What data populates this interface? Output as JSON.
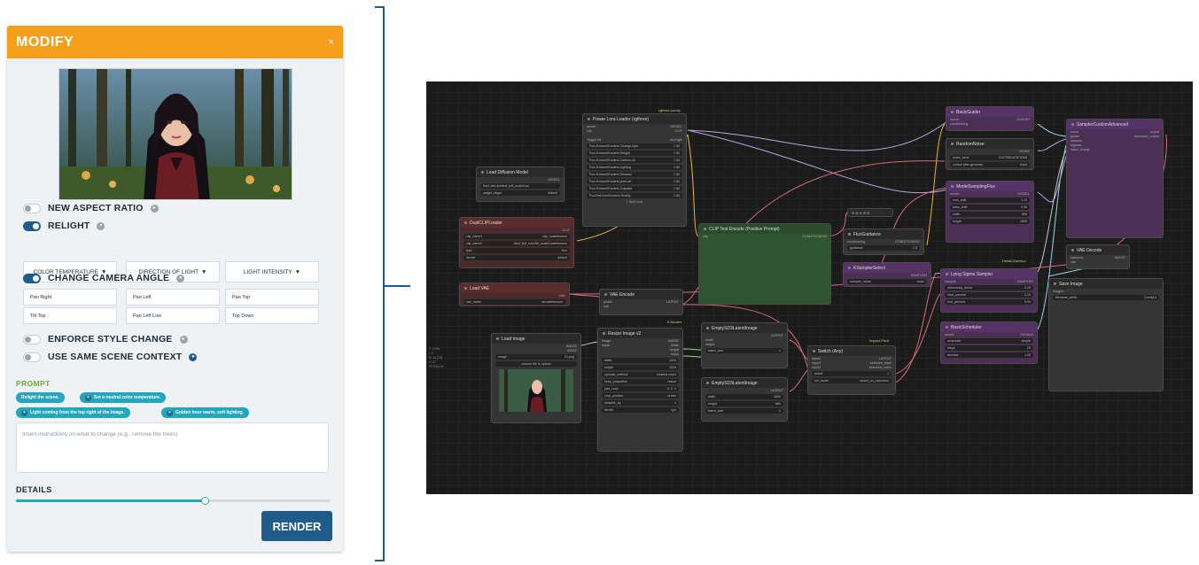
{
  "panel": {
    "title": "MODIFY",
    "close": "×"
  },
  "options": {
    "new_aspect_ratio": "NEW ASPECT RATIO",
    "relight": "RELIGHT",
    "change_camera_angle": "CHANGE CAMERA ANGLE",
    "enforce_style_change": "ENFORCE STYLE CHANGE",
    "use_same_scene_context": "USE SAME SCENE CONTEXT",
    "states": {
      "new_aspect_ratio": false,
      "relight": true,
      "change_camera_angle": true,
      "enforce_style_change": false,
      "use_same_scene_context": false
    }
  },
  "relight_dropdowns": [
    {
      "label": "COLOR TEMPERATURE"
    },
    {
      "label": "DIRECTION OF LIGHT"
    },
    {
      "label": "LIGHT INTENSITY"
    }
  ],
  "camera_buttons": [
    "Pan Right",
    "Pan Left",
    "Pan Top",
    "Tilt Top",
    "Pan Left Low",
    "Top Down"
  ],
  "prompt": {
    "header": "PROMPT",
    "chips": [
      "Relight the scene.",
      "Set a neutral color temperature.",
      "Light coming from the top right of the image.",
      "Golden hour warm, soft lighting."
    ],
    "placeholder": "Insert instructions on what to change (e.g., remove the trees)"
  },
  "details": {
    "header": "DETAILS",
    "slider_value": 0.6
  },
  "render_label": "RENDER",
  "accent_colors": {
    "header": "#f4a01c",
    "primary": "#1f5c8c",
    "chip": "#25a6bd",
    "prompt_header": "#6ea82c"
  },
  "canvas": {
    "stats": [
      "T: 0.00s",
      "I: 0",
      "N: 29 [29]",
      "V: 47",
      "FPS:60.00"
    ],
    "group_tags": {
      "rgthree": "rgthree-comfy",
      "kjnodes": "KJNodes",
      "impact": "Impact-Pack",
      "detail": "Detail-Daemon"
    },
    "nodes": {
      "power_lora": {
        "title": "Power Lora Loader (rgthree)",
        "in1": "model",
        "in2": "clip",
        "out1": "MODEL",
        "out2": "CLIP",
        "toggle": "Toggle All",
        "strength": "strength",
        "add": "+ Add Lora",
        "loras": [
          "Flux-Kontext/Kontext-Change-light",
          "Flux-Kontext/Kontext-Relight",
          "Flux-Kontext/Kontext-Cartoon-AI",
          "Flux-Kontext/Kontext-Lighting",
          "Flux-Kontext/Kontext-Shadow",
          "Flux-Kontext/Kontext-pixel-art",
          "Flux-Kontext/Kontext-Outpaint",
          "FluxTextOver/Kontext-Reality"
        ],
        "lora_values": [
          "1.00",
          "1.00",
          "1.00",
          "1.00",
          "1.00",
          "1.00",
          "1.00",
          "1.00"
        ]
      },
      "diffusion": {
        "title": "Load Diffusion Model",
        "out": "MODEL",
        "f1": "flux1-dev-kontext_fp8_scaled.sd",
        "f2k": "weight_dtype",
        "f2v": "default"
      },
      "dualclip": {
        "title": "DualCLIPLoader",
        "out": "CLIP",
        "f1k": "clip_name1",
        "f1v": "clip_l.safetensors",
        "f2k": "clip_name2",
        "f2v": "t5xxl_fp8_e4m3fn_scaled.safetensors",
        "f3k": "type",
        "f3v": "flux",
        "f4k": "device",
        "f4v": "default"
      },
      "loadvae": {
        "title": "Load VAE",
        "out": "VAE",
        "f1k": "vae_name",
        "f1v": "ae.safetensors"
      },
      "vaeencode": {
        "title": "VAE Encode",
        "in1": "pixels",
        "in2": "vae",
        "out": "LATENT"
      },
      "clipencode": {
        "title": "CLIP Text Encode (Positive Prompt)",
        "in": "clip",
        "out": "CONDITIONING"
      },
      "fluxguidance": {
        "title": "FluxGuidance",
        "in": "conditioning",
        "out": "CONDITIONING",
        "fk": "guidance",
        "fv": "2.5"
      },
      "basicguider": {
        "title": "BasicGuider",
        "in1": "model",
        "in2": "conditioning",
        "out": "GUIDER"
      },
      "randomnoise": {
        "title": "RandomNoise",
        "out": "NOISE",
        "f1k": "noise_seed",
        "f1v": "0157559107874306",
        "f2k": "control after generate",
        "f2v": "fixed"
      },
      "modelsampling": {
        "title": "ModelSamplingFlux",
        "in": "model",
        "out": "MODEL",
        "f1k": "max_shift",
        "f1v": "1.15",
        "f2k": "base_shift",
        "f2v": "0.50",
        "f3k": "width",
        "f3v": "896",
        "f4k": "height",
        "f4v": "1808"
      },
      "samplercustom": {
        "title": "SamplerCustomAdvanced",
        "in1": "noise",
        "in2": "guider",
        "in3": "sampler",
        "in4": "sigmas",
        "in5": "latent_image",
        "out1": "output",
        "out2": "denoised_output"
      },
      "ksamplerselect": {
        "title": "KSamplerSelect",
        "out": "SAMPLER",
        "fk": "sampler_name",
        "fv": "euler"
      },
      "lyingsigma": {
        "title": "Lying Sigma Sampler",
        "in": "sampler",
        "out": "SAMPLER",
        "f1k": "dishonesty_factor",
        "f1v": "0.00",
        "f2k": "start_percent",
        "f2v": "0.10",
        "f3k": "end_percent",
        "f3v": "0.90"
      },
      "vaedecode": {
        "title": "VAE Decode",
        "in1": "samples",
        "in2": "vae",
        "out": "IMAGE"
      },
      "saveimage": {
        "title": "Save Image",
        "in": "images",
        "fk": "filename_prefix",
        "fv": "ComfyUI"
      },
      "basicscheduler": {
        "title": "BasicScheduler",
        "in": "model",
        "out": "SIGMAS",
        "f1k": "scheduler",
        "f1v": "simple",
        "f2k": "steps",
        "f2v": "20",
        "f3k": "denoise",
        "f3v": "1.00"
      },
      "loadimage": {
        "title": "Load Image",
        "out1": "IMAGE",
        "out2": "MASK",
        "fk": "image",
        "fv": "01.png",
        "upload": "choose file to upload"
      },
      "resize": {
        "title": "Resize Image v2",
        "in1": "image",
        "in2": "mask",
        "out1": "IMAGE",
        "out2": "width",
        "out3": "height",
        "out4": "mask",
        "fields": [
          [
            "width",
            "1024"
          ],
          [
            "height",
            "1024"
          ],
          [
            "upscale_method",
            "nearest-exact"
          ],
          [
            "keep_proportion",
            "resize"
          ],
          [
            "pad_color",
            "0, 0, 0"
          ],
          [
            "crop_position",
            "center"
          ],
          [
            "divisible_by",
            "2"
          ],
          [
            "device",
            "cpu"
          ]
        ]
      },
      "emptylatent1": {
        "title": "EmptySD3LatentImage",
        "in1": "width",
        "in2": "height",
        "out": "LATENT",
        "fk": "batch_size",
        "fv": "1"
      },
      "emptylatent2": {
        "title": "EmptySD3LatentImage",
        "out": "LATENT",
        "f1k": "width",
        "f1v": "1600",
        "f2k": "height",
        "f2v": "880",
        "f3k": "batch_size",
        "f3v": "1"
      },
      "switch": {
        "title": "Switch (Any)",
        "in1": "input1",
        "in2": "input2",
        "in3": "input3",
        "out1": "LATENT",
        "out2": "selected_label",
        "out3": "selected_index",
        "f1k": "select",
        "f1v": "1",
        "f2k": "sel_mode",
        "f2v": "select_on_execution"
      },
      "reroute": {
        "title": "⊕ ⊕ ⊕ ⊕ ⊕"
      }
    }
  }
}
